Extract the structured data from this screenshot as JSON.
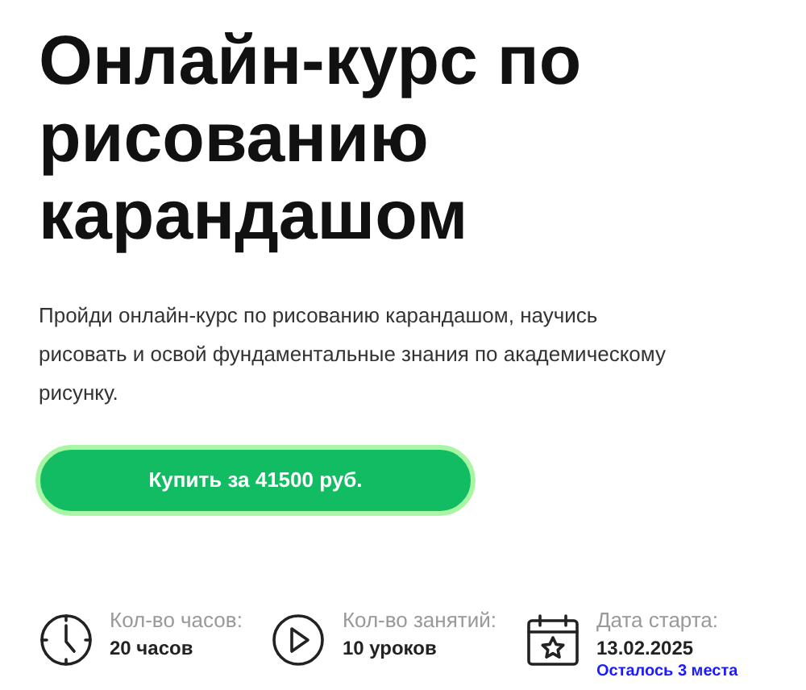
{
  "title": "Онлайн-курс по рисованию карандашом",
  "description": "Пройди онлайн-курс по рисованию карандашом, научись рисовать и освой фундаментальные знания по академическому рисунку.",
  "buy_button": "Купить за 41500 руб.",
  "stats": [
    {
      "kind": "clock",
      "label": "Кол-во часов:",
      "value": "20 часов"
    },
    {
      "kind": "play",
      "label": "Кол-во занятий:",
      "value": "10 уроков"
    },
    {
      "kind": "calendar",
      "label": "Дата старта:",
      "value": "13.02.2025",
      "note": "Осталось 3 места"
    }
  ]
}
